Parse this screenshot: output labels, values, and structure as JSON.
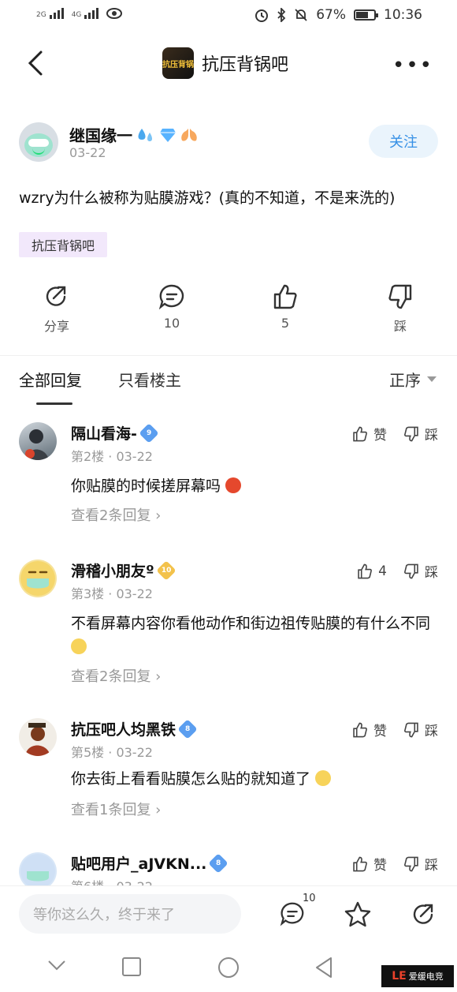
{
  "status_bar": {
    "signal1": "2G",
    "signal2": "4G",
    "battery_percent": "67%",
    "battery_level": 0.67,
    "time": "10:36"
  },
  "header": {
    "title": "抗压背锅吧",
    "logo_text": "抗压背锅"
  },
  "post": {
    "author": "继国缘一",
    "date": "03-22",
    "follow_label": "关注",
    "text": "wzry为什么被称为贴膜游戏？(真的不知道，不是来洗的)",
    "tag": "抗压背锅吧"
  },
  "actions": {
    "share": "分享",
    "comments": "10",
    "likes": "5",
    "dislike": "踩"
  },
  "tabs": {
    "all_replies": "全部回复",
    "owner_only": "只看楼主",
    "sort": "正序"
  },
  "comments": [
    {
      "name": "隔山看海-",
      "level": "9",
      "level_color": "#5b9ef0",
      "meta": "第2楼 · 03-22",
      "text": "你贴膜的时候搓屏幕吗",
      "more": "查看2条回复 ›",
      "like": "赞",
      "dislike": "踩"
    },
    {
      "name": "滑稽小朋友º",
      "level": "10",
      "level_color": "#f3c24b",
      "meta": "第3楼 · 03-22",
      "text": "不看屏幕内容你看他动作和街边祖传贴膜的有什么不同",
      "more": "查看2条回复 ›",
      "like": "4",
      "dislike": "踩"
    },
    {
      "name": "抗压吧人均黑铁",
      "level": "8",
      "level_color": "#5b9ef0",
      "meta": "第5楼 · 03-22",
      "text": "你去街上看看贴膜怎么贴的就知道了",
      "more": "查看1条回复 ›",
      "like": "赞",
      "dislike": "踩"
    },
    {
      "name": "贴吧用户_aJVKN...",
      "level": "8",
      "level_color": "#5b9ef0",
      "meta": "第6楼 · 03-22",
      "like": "赞",
      "dislike": "踩"
    }
  ],
  "bottom_bar": {
    "placeholder": "等你这么久，终于来了",
    "comment_count": "10"
  },
  "watermark": {
    "logo": "LE",
    "text": "爱缓电竞"
  },
  "colors": {
    "accent_blue": "#3690e6",
    "follow_bg": "#eaf4fc",
    "tag_bg": "#f2e8fb"
  }
}
